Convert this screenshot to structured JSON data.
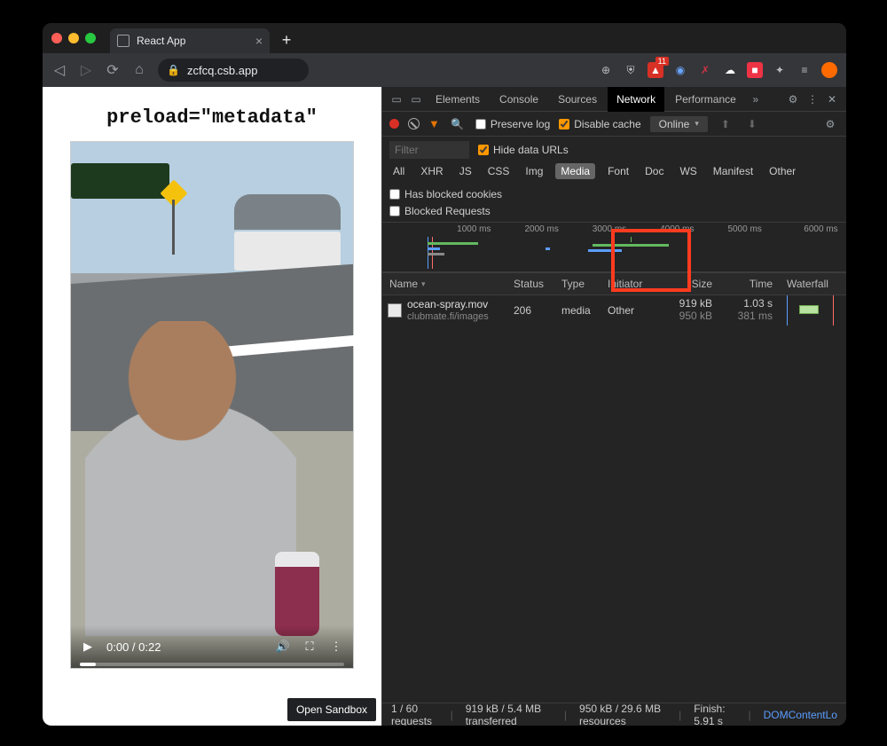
{
  "browser": {
    "tab_title": "React App",
    "url": "zcfcq.csb.app"
  },
  "page": {
    "heading": "preload=\"metadata\"",
    "video_time": "0:00 / 0:22",
    "open_sandbox": "Open Sandbox"
  },
  "devtools": {
    "panels": [
      "Elements",
      "Console",
      "Sources",
      "Network",
      "Performance"
    ],
    "active_panel": "Network",
    "toolbar": {
      "preserve_log": "Preserve log",
      "disable_cache": "Disable cache",
      "throttling": "Online"
    },
    "filter_placeholder": "Filter",
    "hide_data_urls": "Hide data URLs",
    "types": [
      "All",
      "XHR",
      "JS",
      "CSS",
      "Img",
      "Media",
      "Font",
      "Doc",
      "WS",
      "Manifest",
      "Other"
    ],
    "active_type": "Media",
    "has_blocked_cookies": "Has blocked cookies",
    "blocked_requests": "Blocked Requests",
    "timeline_ticks": [
      "1000 ms",
      "2000 ms",
      "3000 ms",
      "4000 ms",
      "5000 ms",
      "6000 ms"
    ],
    "columns": {
      "name": "Name",
      "status": "Status",
      "type": "Type",
      "initiator": "Initiator",
      "size": "Size",
      "time": "Time",
      "waterfall": "Waterfall"
    },
    "rows": [
      {
        "name": "ocean-spray.mov",
        "domain": "clubmate.fi/images",
        "status": "206",
        "type": "media",
        "initiator": "Other",
        "size_top": "919 kB",
        "size_bottom": "950 kB",
        "time_top": "1.03 s",
        "time_bottom": "381 ms"
      }
    ],
    "status": {
      "requests": "1 / 60 requests",
      "transferred": "919 kB / 5.4 MB transferred",
      "resources": "950 kB / 29.6 MB resources",
      "finish": "Finish: 5.91 s",
      "domcontent": "DOMContentLo"
    }
  }
}
